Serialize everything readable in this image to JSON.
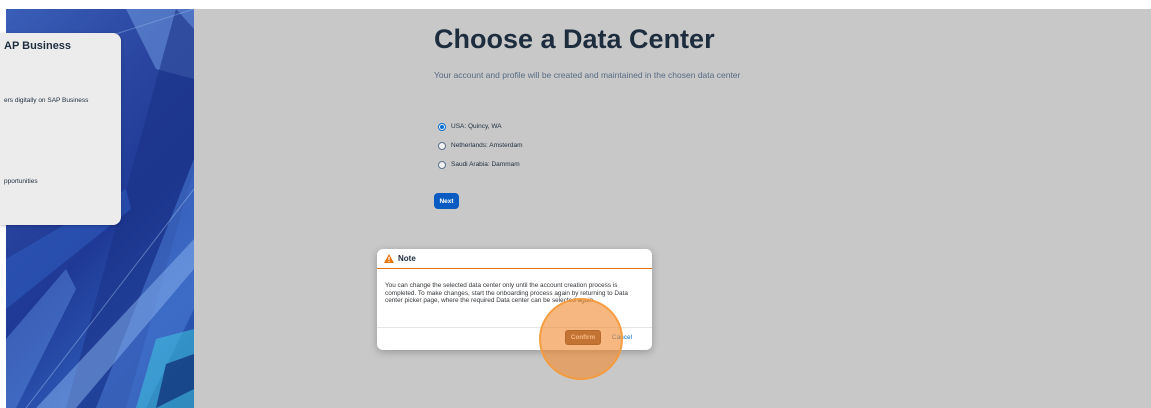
{
  "left_panel": {
    "card_title": "AP Business",
    "card_line_1": "ers digitally on SAP Business",
    "card_line_2": "pportunities"
  },
  "main": {
    "title": "Choose a Data Center",
    "subtitle": "Your account and profile will be created and maintained in the chosen data center",
    "options": [
      {
        "label": "USA: Quincy, WA",
        "selected": true
      },
      {
        "label": "Netherlands: Amsterdam",
        "selected": false
      },
      {
        "label": "Saudi Arabia: Dammam",
        "selected": false
      }
    ],
    "next_label": "Next"
  },
  "dialog": {
    "title": "Note",
    "icon": "warning-icon",
    "body": "You can change the selected data center only until the account creation process is completed. To make changes, start the onboarding process again by returning to Data center picker page, where the required Data center can be selected again.",
    "confirm_label": "Confirm",
    "cancel_label": "Cancel"
  },
  "colors": {
    "accent": "#0a6ed1",
    "warning": "#e9730c",
    "highlight": "#f08c32"
  }
}
